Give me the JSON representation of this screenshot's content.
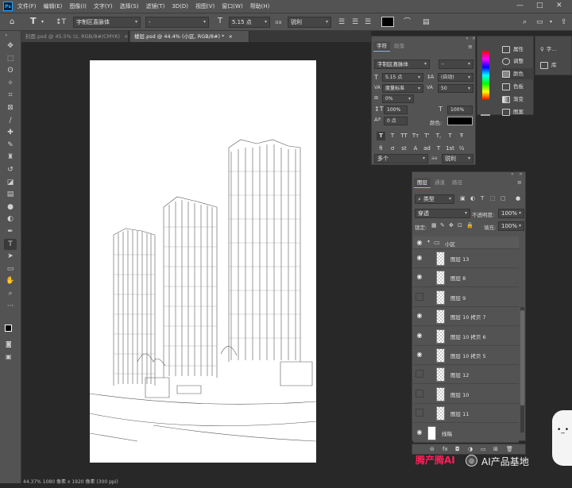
{
  "menu": {
    "logo": "Ps",
    "items": [
      "文件(F)",
      "编辑(E)",
      "图像(I)",
      "文字(Y)",
      "选择(S)",
      "滤镜(T)",
      "3D(D)",
      "视图(V)",
      "窗口(W)",
      "帮助(H)"
    ],
    "window_controls": [
      "—",
      "□",
      "✕"
    ]
  },
  "options_bar": {
    "tool_glyph": "T",
    "font_family": "字制区喜脉体",
    "font_style": "-",
    "size_glyph": "T",
    "font_size": "5.15 点",
    "aa_glyph": "aa",
    "anti_alias": "锐利",
    "color_swatch": "#000000"
  },
  "doc_tabs": [
    {
      "label": "封面.psd @ 45.5% (z, RGB/8#/CMYK)",
      "close": "×"
    },
    {
      "label": "楼层.psd @ 44.4% (小区, RGB/8#) *",
      "close": "×"
    }
  ],
  "status_bar": {
    "text": "44.37%   1080 像素 x 1920 像素 (300 ppi)"
  },
  "tools": [
    {
      "name": "move-tool",
      "glyph": "✥"
    },
    {
      "name": "marquee-tool",
      "glyph": "⬚"
    },
    {
      "name": "lasso-tool",
      "glyph": "ʘ"
    },
    {
      "name": "magic-wand-tool",
      "glyph": "✧"
    },
    {
      "name": "crop-tool",
      "glyph": "⌗"
    },
    {
      "name": "frame-tool",
      "glyph": "⊠"
    },
    {
      "name": "eyedropper-tool",
      "glyph": "∕"
    },
    {
      "name": "healing-tool",
      "glyph": "✚"
    },
    {
      "name": "brush-tool",
      "glyph": "✎"
    },
    {
      "name": "stamp-tool",
      "glyph": "♜"
    },
    {
      "name": "history-brush-tool",
      "glyph": "↺"
    },
    {
      "name": "eraser-tool",
      "glyph": "◪"
    },
    {
      "name": "gradient-tool",
      "glyph": "▤"
    },
    {
      "name": "blur-tool",
      "glyph": "●"
    },
    {
      "name": "dodge-tool",
      "glyph": "◐"
    },
    {
      "name": "pen-tool",
      "glyph": "✒"
    },
    {
      "name": "type-tool",
      "glyph": "T"
    },
    {
      "name": "path-select-tool",
      "glyph": "➤"
    },
    {
      "name": "shape-tool",
      "glyph": "▭"
    },
    {
      "name": "hand-tool",
      "glyph": "✋"
    },
    {
      "name": "zoom-tool",
      "glyph": "⌕"
    },
    {
      "name": "more-tools",
      "glyph": "···"
    }
  ],
  "character_panel": {
    "tabs": [
      "字符",
      "段落"
    ],
    "font_family": "字制区喜脉体",
    "font_style": "-",
    "font_size": "5.15 点",
    "leading": "(自动)",
    "kerning": "度量标准",
    "tracking": "50",
    "tsume": "0%",
    "vscale": "100%",
    "hscale": "100%",
    "baseline": "0 点",
    "color_label": "颜色:",
    "glyph_row1": [
      "T",
      "T",
      "TT",
      "Tт",
      "T'",
      "T,",
      "T",
      "Ŧ"
    ],
    "glyph_row2": [
      "fi",
      "ơ",
      "st",
      "A",
      "ad",
      "T",
      "1st",
      "½"
    ],
    "language": "多个",
    "aa": "锐利"
  },
  "side_panel": {
    "items": [
      "属性",
      "调整",
      "颜色",
      "色板",
      "渐变",
      "图案"
    ],
    "right_items": [
      "字...",
      "库"
    ]
  },
  "layers_panel": {
    "tabs": [
      "图层",
      "通道",
      "路径"
    ],
    "filter_kind": "类型",
    "blend_mode": "穿透",
    "opacity_label": "不透明度:",
    "opacity": "100%",
    "lock_label": "锁定:",
    "fill_label": "填充:",
    "fill": "100%",
    "group_name": "小区",
    "layers": [
      {
        "name": "图层 13",
        "visible": true
      },
      {
        "name": "图层 8",
        "visible": true
      },
      {
        "name": "图层 9",
        "visible": false
      },
      {
        "name": "图层 10 拷贝 7",
        "visible": true
      },
      {
        "name": "图层 10 拷贝 6",
        "visible": true
      },
      {
        "name": "图层 10 拷贝 5",
        "visible": true
      },
      {
        "name": "图层 12",
        "visible": false
      },
      {
        "name": "图层 10",
        "visible": false
      },
      {
        "name": "图层 11",
        "visible": false
      }
    ],
    "bottom_layer": "线稿",
    "footer_icons": [
      "⊝",
      "fx",
      "◘",
      "◑",
      "▭",
      "⊞",
      "🗑"
    ]
  },
  "watermark": {
    "text1": "腾产腾AI",
    "text2": "AI产品基地"
  },
  "colors": {
    "ui_dark": "#535353",
    "workspace": "#282828",
    "accent": "#31a8ff",
    "watermark_red": "#ff1f5a"
  }
}
